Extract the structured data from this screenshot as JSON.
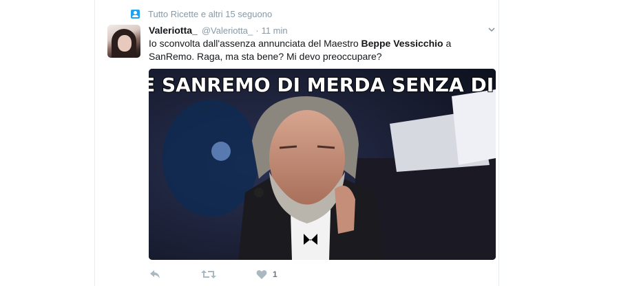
{
  "context": {
    "icon": "person-icon",
    "text": "Tutto Ricette e altri 15 seguono"
  },
  "tweet": {
    "name": "Valeriotta_",
    "handle": "@Valeriotta_",
    "separator": "·",
    "time": "11 min",
    "text_part1": "Io sconvolta dall'assenza annunciata del Maestro ",
    "text_bold": "Beppe Vessicchio",
    "text_part2": " a SanRemo. Raga, ma sta bene? Mi devo preoccupare?",
    "media_caption": "CHE SANREMO DI MERDA SENZA DI ME",
    "likes": "1"
  },
  "colors": {
    "accent": "#1da1f2",
    "muted": "#8899a6",
    "text": "#14171a"
  }
}
